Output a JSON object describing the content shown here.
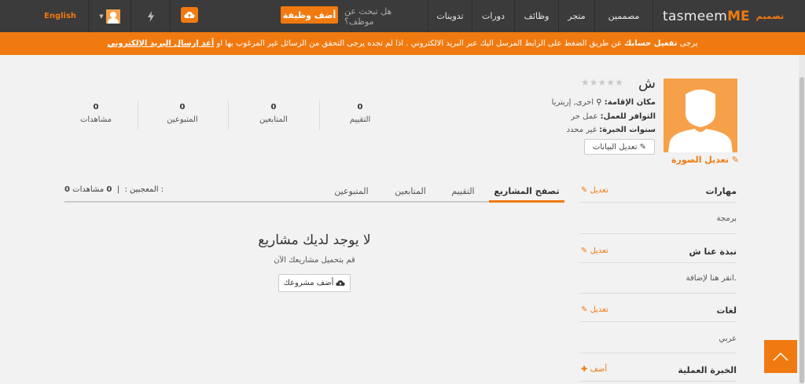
{
  "nav": {
    "logo_latin": "tasmeem",
    "logo_me": "ME",
    "logo_arabic": "تصميم",
    "items": [
      "مصممين",
      "متجر",
      "وظائف",
      "دورات",
      "تدوينات"
    ],
    "search_prompt": "هل تبحث عن موظف؟",
    "add_job": "أضف وظيفة",
    "language": "English"
  },
  "alert": {
    "prefix": "يرجى",
    "activate": "تفعيل حسابك",
    "middle": "عن طريق الضغط على الرابط المرسل اليك عبر البريد الالكتروني . اذا لم تجده يرجى التحقق من الرسائل غير المرغوب بها او",
    "resend": "أعد إرسال البريد الإلكتروني"
  },
  "profile": {
    "name": "ش",
    "rating": 0,
    "location_label": "مكان الإقامة:",
    "location_value": "اخرى, إريتريا",
    "availability_label": "التوافر للعمل:",
    "availability_value": "عمل حر",
    "experience_label": "سنوات الخبرة:",
    "experience_value": "غير محدد",
    "edit_data": "تعديل البيانات",
    "edit_photo": "تعديل الصورة"
  },
  "stats": [
    {
      "value": "0",
      "label": "التقييم"
    },
    {
      "value": "0",
      "label": "المتابعين"
    },
    {
      "value": "0",
      "label": "المتبوعين"
    },
    {
      "value": "0",
      "label": "مشاهدات"
    }
  ],
  "tabs": [
    "تصفح المشاريع",
    "التقييم",
    "المتابعين",
    "المتبوعين"
  ],
  "counters": {
    "views_label": "مشاهدات :",
    "views_value": "0",
    "likes_label": "المعجبين :",
    "likes_value": "0"
  },
  "empty": {
    "title": "لا يوجد لديك مشاريع",
    "subtitle": "قم بتحميل مشاريعك الآن",
    "button": "أضف مشروعك"
  },
  "sections": {
    "skills": {
      "title": "مهارات",
      "action": "تعديل",
      "body": "برمجة"
    },
    "about": {
      "title": "نبذة عنا ش",
      "action": "تعديل",
      "body": "انقر هنا لإضافة."
    },
    "languages": {
      "title": "لغات",
      "action": "تعديل",
      "body": "عربي"
    },
    "experience": {
      "title": "الخبرة العملية",
      "action": "أضف"
    }
  },
  "colors": {
    "accent": "#f07a10",
    "nav_bg": "#3b3b3b",
    "page_bg": "#f2f2f2"
  }
}
